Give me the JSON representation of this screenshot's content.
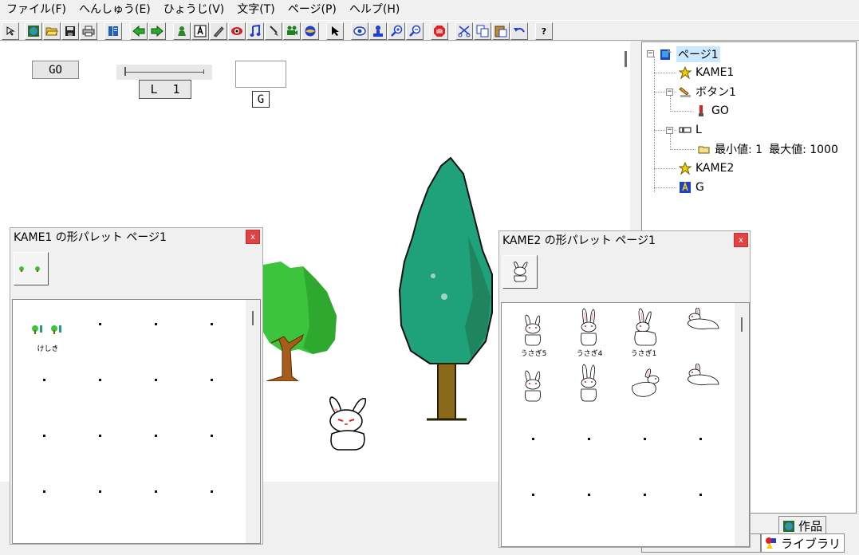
{
  "menubar": {
    "items": [
      "ファイル(F)",
      "へんしゅう(E)",
      "ひょうじ(V)",
      "文字(T)",
      "ページ(P)",
      "ヘルプ(H)"
    ]
  },
  "toolbar": {
    "buttons": [
      "cursor-small",
      "world",
      "open-folder",
      "save",
      "print",
      "book",
      "back-arrow",
      "forward-arrow",
      "person",
      "text-a",
      "pen",
      "eye-sprite",
      "music",
      "brush",
      "camera",
      "globe",
      "pointer",
      "eye",
      "stamp",
      "zoom-in",
      "zoom-out",
      "stop",
      "cut",
      "copy",
      "paste",
      "undo",
      "help"
    ],
    "help_label": "?"
  },
  "stage": {
    "go_button": "GO",
    "slider_label": "L",
    "slider_value": "1",
    "slider_level": 0,
    "g_label": "G"
  },
  "tree": {
    "root": "ページ1",
    "kame1": "KAME1",
    "button": "ボタン1",
    "go": "GO",
    "l_item": "L",
    "min_label": "最小値: 1",
    "max_label": "最大値: 1000",
    "kame2": "KAME2",
    "g_item": "G",
    "toggle_open": "−"
  },
  "tabs": {
    "works": "作品",
    "library": "ライブラリ"
  },
  "palette1": {
    "title": "KAME1 の形パレット ページ1",
    "close": "x",
    "item_label": "けしき"
  },
  "palette2": {
    "title": "KAME2 の形パレット ページ1",
    "close": "x",
    "labels": [
      "うさぎ5",
      "うさぎ4",
      "うさぎ1"
    ]
  }
}
